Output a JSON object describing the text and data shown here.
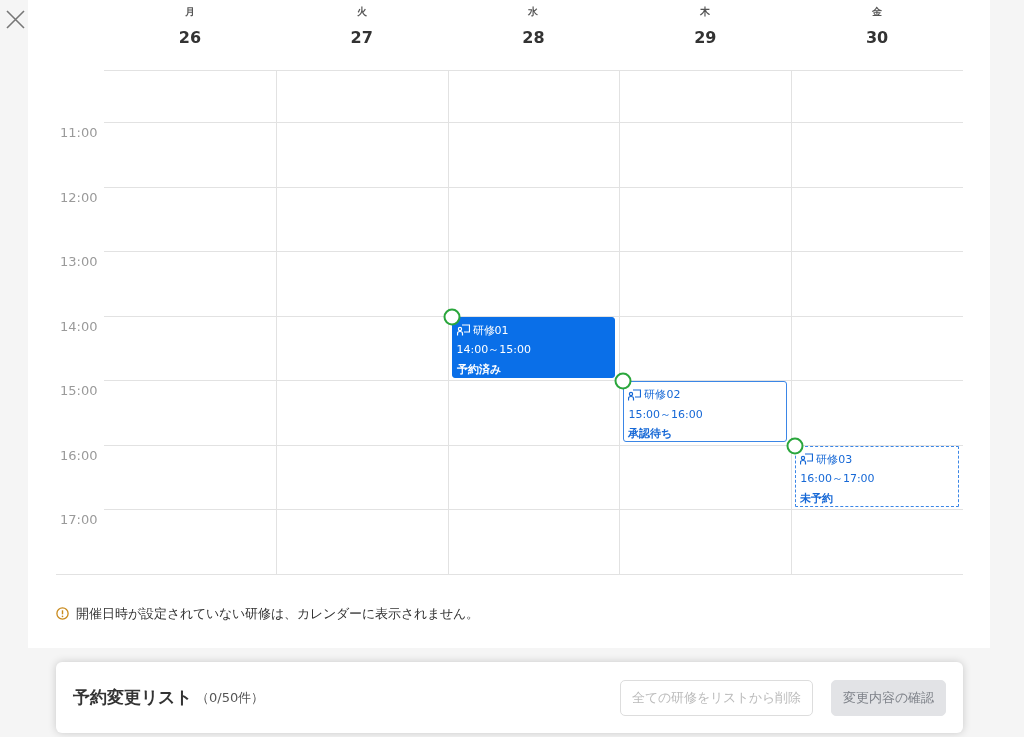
{
  "days": [
    {
      "weekday": "月",
      "date": "26"
    },
    {
      "weekday": "火",
      "date": "27"
    },
    {
      "weekday": "水",
      "date": "28",
      "events": [
        {
          "kind": "booked",
          "title": "研修01",
          "time": "14:00～15:00",
          "status": "予約済み"
        }
      ]
    },
    {
      "weekday": "木",
      "date": "29",
      "events": [
        {
          "kind": "pending",
          "title": "研修02",
          "time": "15:00～16:00",
          "status": "承認待ち"
        }
      ]
    },
    {
      "weekday": "金",
      "date": "30",
      "events": [
        {
          "kind": "unbooked",
          "title": "研修03",
          "time": "16:00～17:00",
          "status": "未予約"
        }
      ]
    }
  ],
  "time_labels": [
    "11:00",
    "12:00",
    "13:00",
    "14:00",
    "15:00",
    "16:00",
    "17:00"
  ],
  "notice": "開催日時が設定されていない研修は、カレンダーに表示されません。",
  "change_list": {
    "title": "予約変更リスト",
    "count": "（0/50件）",
    "buttons": [
      {
        "kind": "outline",
        "label": "全ての研修をリストから削除",
        "disabled": true
      },
      {
        "kind": "primary",
        "label": "変更内容の確認",
        "disabled": true
      }
    ]
  }
}
